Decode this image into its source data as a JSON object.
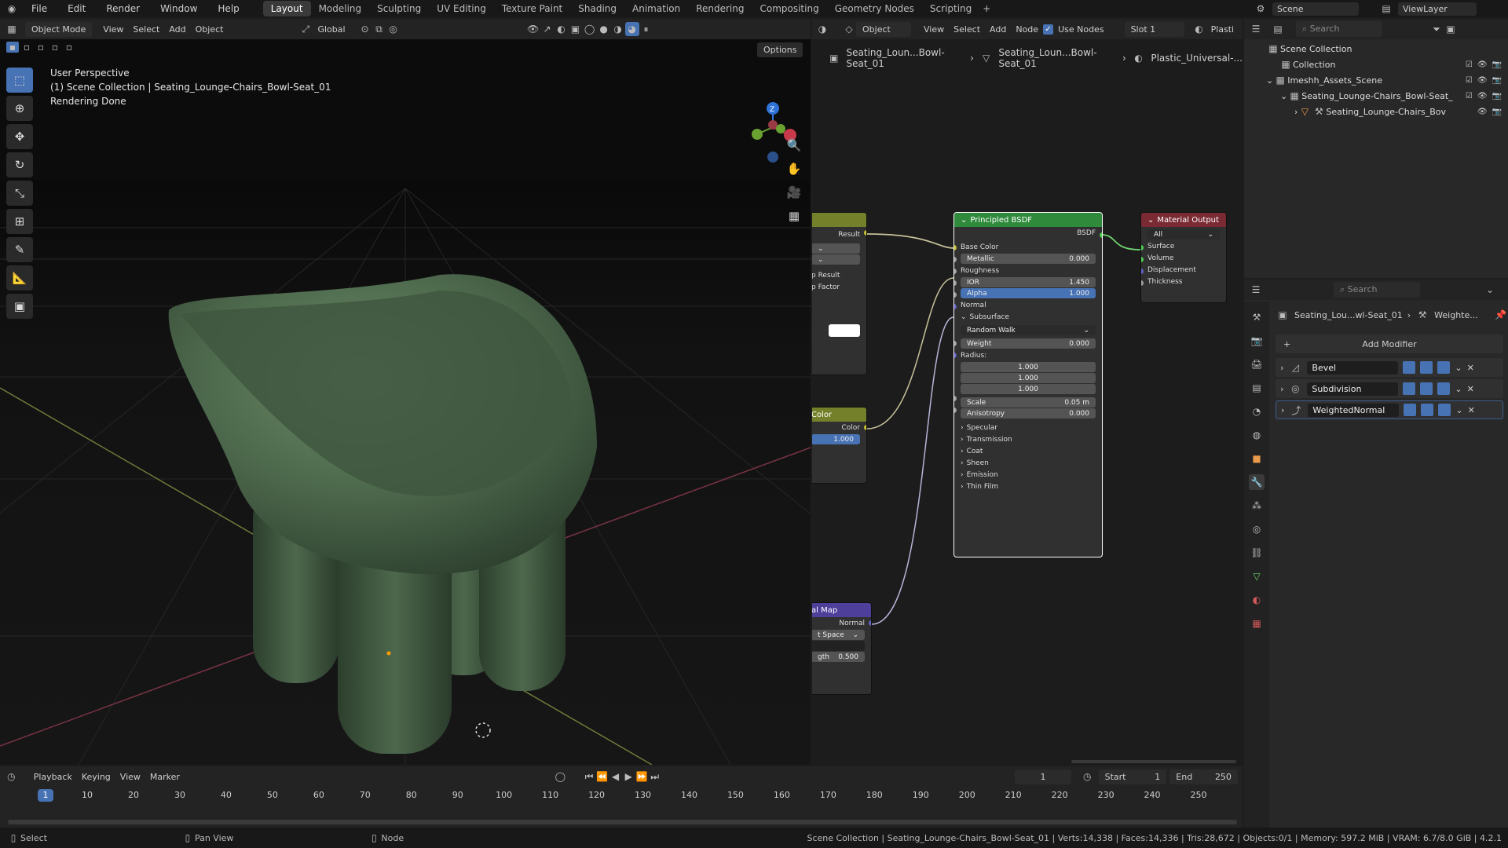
{
  "topbar": {
    "menus": [
      "File",
      "Edit",
      "Render",
      "Window",
      "Help"
    ],
    "workspaces": [
      "Layout",
      "Modeling",
      "Sculpting",
      "UV Editing",
      "Texture Paint",
      "Shading",
      "Animation",
      "Rendering",
      "Compositing",
      "Geometry Nodes",
      "Scripting"
    ],
    "active_workspace": "Layout",
    "scene": "Scene",
    "view_layer": "ViewLayer"
  },
  "viewport": {
    "mode": "Object Mode",
    "menus": [
      "View",
      "Select",
      "Add",
      "Object"
    ],
    "transform": "Global",
    "options": "Options",
    "overlay_line1": "User Perspective",
    "overlay_line2": "(1) Scene Collection | Seating_Lounge-Chairs_Bowl-Seat_01",
    "overlay_line3": "Rendering Done",
    "gizmo_z": "Z",
    "object_color": "#4f6b4e"
  },
  "node_editor": {
    "type": "Object",
    "menus": [
      "View",
      "Select",
      "Add",
      "Node"
    ],
    "use_nodes": "Use Nodes",
    "slot": "Slot 1",
    "material_short": "Plasti",
    "breadcrumb": [
      "Seating_Loun...Bowl-Seat_01",
      "Seating_Loun...Bowl-Seat_01",
      "Plastic_Universal-..."
    ],
    "left_node_top": {
      "rows": [
        "Result",
        "p Result",
        "p Factor"
      ]
    },
    "left_node_color": {
      "title": "Color",
      "output": "Color",
      "value": "1.000"
    },
    "left_node_normal": {
      "title": "al Map",
      "output": "Normal",
      "space": "t Space",
      "strength_label": "gth",
      "strength": "0.500"
    },
    "bsdf": {
      "title": "Principled BSDF",
      "output": "BSDF",
      "base_color": "Base Color",
      "metallic_label": "Metallic",
      "metallic": "0.000",
      "roughness": "Roughness",
      "ior_label": "IOR",
      "ior": "1.450",
      "alpha_label": "Alpha",
      "alpha": "1.000",
      "normal": "Normal",
      "subsurface": "Subsurface",
      "method": "Random Walk",
      "weight_label": "Weight",
      "weight": "0.000",
      "radius": "Radius:",
      "radius_values": [
        "1.000",
        "1.000",
        "1.000"
      ],
      "scale_label": "Scale",
      "scale": "0.05 m",
      "anisotropy_label": "Anisotropy",
      "anisotropy": "0.000",
      "panels": [
        "Specular",
        "Transmission",
        "Coat",
        "Sheen",
        "Emission",
        "Thin Film"
      ]
    },
    "output_node": {
      "title": "Material Output",
      "target": "All",
      "inputs": [
        "Surface",
        "Volume",
        "Displacement",
        "Thickness"
      ]
    }
  },
  "outliner": {
    "search_placeholder": "Search",
    "rows": [
      {
        "label": "Scene Collection",
        "indent": 0
      },
      {
        "label": "Collection",
        "indent": 1
      },
      {
        "label": "Imeshh_Assets_Scene",
        "indent": 1
      },
      {
        "label": "Seating_Lounge-Chairs_Bowl-Seat_",
        "indent": 2
      },
      {
        "label": "Seating_Lounge-Chairs_Bov",
        "indent": 3
      }
    ]
  },
  "properties": {
    "search_placeholder": "Search",
    "breadcrumb_object": "Seating_Lou...wl-Seat_01",
    "breadcrumb_modifier": "Weighte...",
    "add_modifier": "Add Modifier",
    "modifiers": [
      "Bevel",
      "Subdivision",
      "WeightedNormal"
    ]
  },
  "timeline": {
    "menus": [
      "Playback",
      "Keying",
      "View",
      "Marker"
    ],
    "current_frame": "1",
    "start_label": "Start",
    "start": "1",
    "end_label": "End",
    "end": "250",
    "ticks": [
      "10",
      "20",
      "30",
      "40",
      "50",
      "60",
      "70",
      "80",
      "90",
      "100",
      "110",
      "120",
      "130",
      "140",
      "150",
      "160",
      "170",
      "180",
      "190",
      "200",
      "210",
      "220",
      "230",
      "240",
      "250"
    ]
  },
  "statusbar": {
    "left": [
      "Select",
      "Pan View",
      "Node"
    ],
    "stats": "Scene Collection | Seating_Lounge-Chairs_Bowl-Seat_01 | Verts:14,338 | Faces:14,336 | Tris:28,672 | Objects:0/1 | Memory: 597.2 MiB | VRAM: 6.7/8.0 GiB | 4.2.1"
  }
}
